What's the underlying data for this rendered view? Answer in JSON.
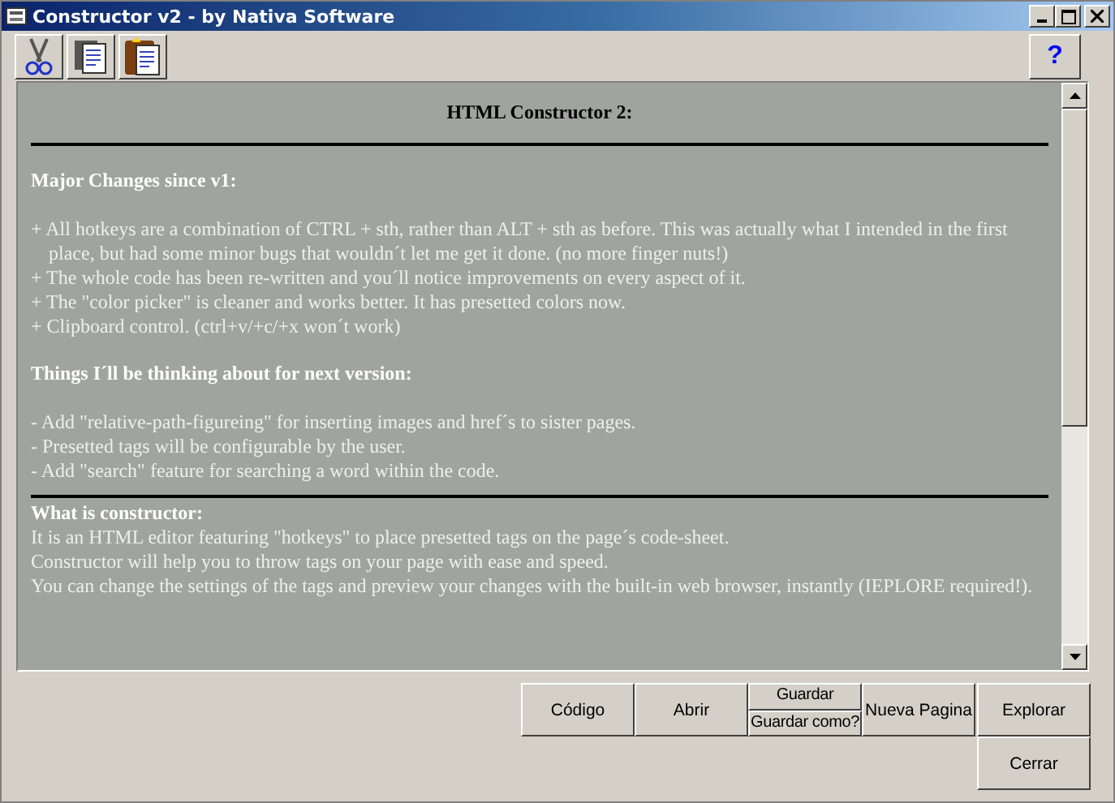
{
  "window": {
    "title": "Constructor v2 - by Nativa Software"
  },
  "help_button": {
    "label": "?"
  },
  "document": {
    "title": "HTML Constructor 2:",
    "sections": [
      {
        "heading": "Major Changes since v1:",
        "rule_before": false,
        "items": [
          "+ All hotkeys are a combination of CTRL + sth, rather than ALT + sth as before. This was actually what I intended in the first place, but had some minor bugs that wouldn´t let me get it done. (no more finger nuts!)",
          "+ The whole code has been re-written and you´ll notice improvements on every aspect of it.",
          "+ The \"color picker\" is cleaner and works better. It has presetted colors now.",
          "+ Clipboard control. (ctrl+v/+c/+x won´t work)"
        ]
      },
      {
        "heading": "Things I´ll be thinking about for next version:",
        "rule_before": false,
        "items": [
          "- Add \"relative-path-figureing\" for inserting images and href´s to sister pages.",
          "- Presetted tags will be configurable by the user.",
          "- Add \"search\" feature for searching a word within the code."
        ]
      },
      {
        "heading": "What is constructor:",
        "rule_before": true,
        "items": [
          "It is an HTML editor featuring \"hotkeys\" to place presetted tags on the page´s code-sheet.",
          "Constructor will help you to throw tags on your page with ease and speed.",
          "You can change the settings of the tags and preview your changes with the built-in web browser, instantly (IEPLORE required!)."
        ]
      }
    ]
  },
  "buttons": [
    {
      "kind": "single",
      "label": "Código"
    },
    {
      "kind": "single",
      "label": "Abrir"
    },
    {
      "kind": "split",
      "top": "Guardar",
      "bottom": "Guardar como?"
    },
    {
      "kind": "single",
      "label": "Nueva Pagina"
    },
    {
      "kind": "stack",
      "top": "Explorar",
      "bottom": "Cerrar"
    }
  ]
}
